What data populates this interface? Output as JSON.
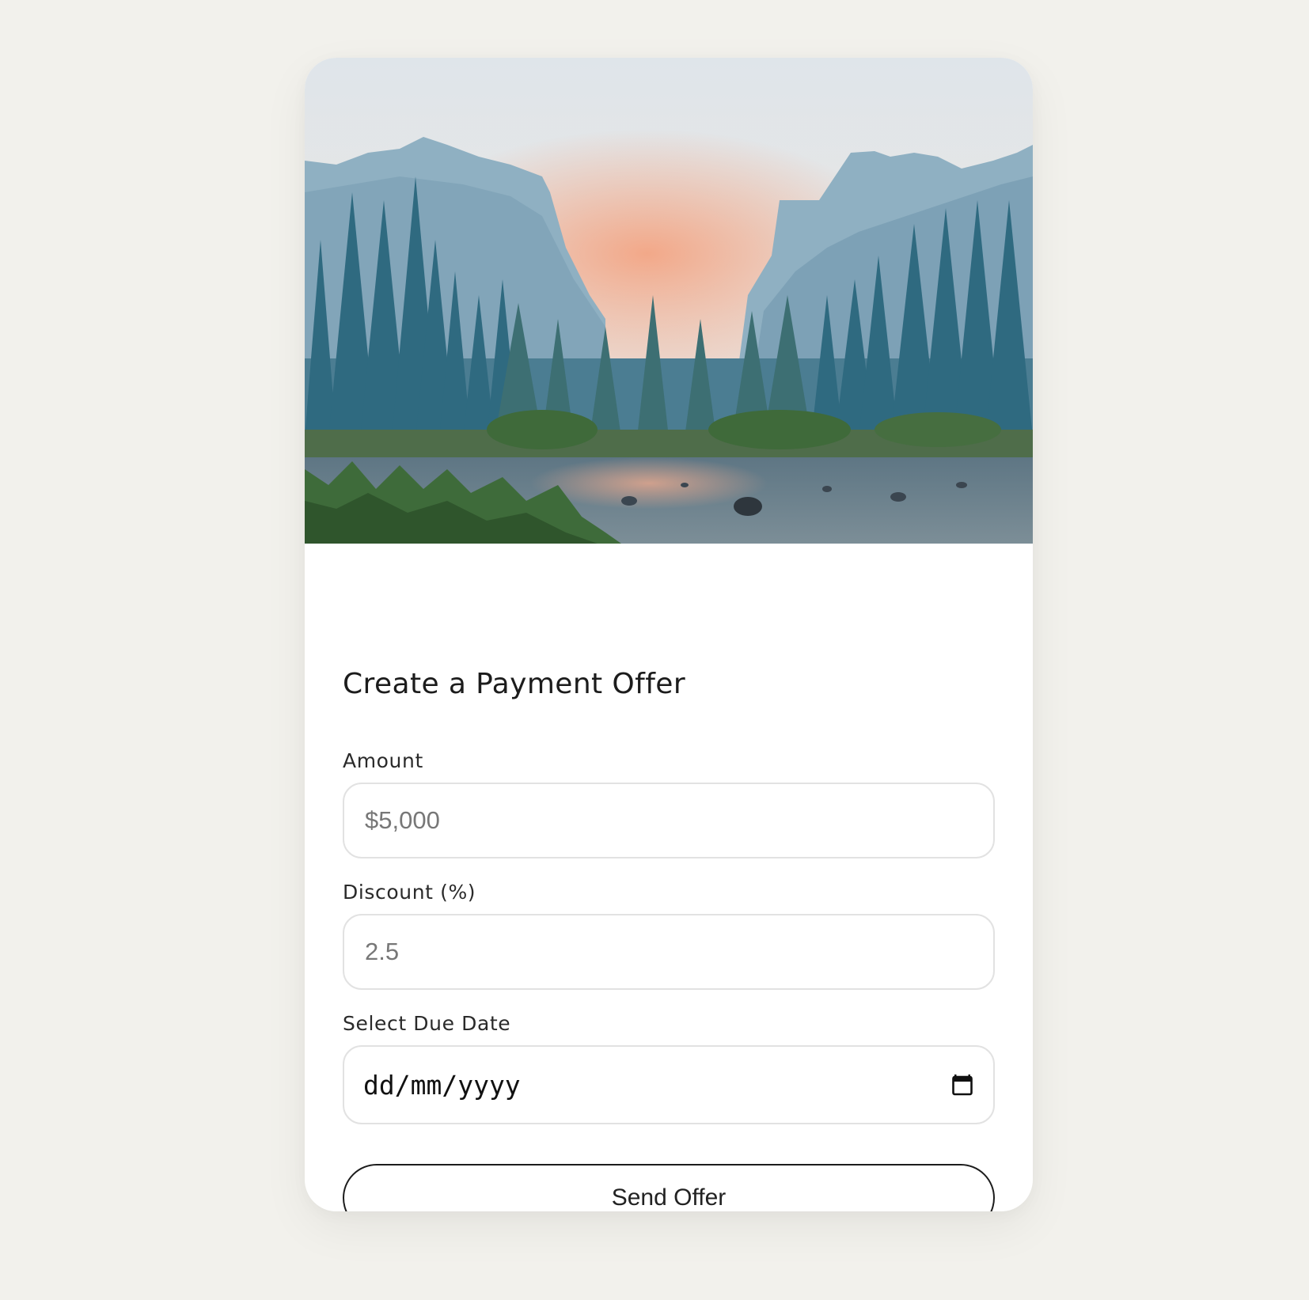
{
  "hero_image": {
    "icon": "mountain-river-landscape",
    "colors": {
      "sky_top": "#dfe5ea",
      "sky_glow": "#f3a584",
      "mountains": "#7fa3b8",
      "trees": "#2f6a80",
      "water": "#6f8592",
      "grass": "#3f6a3a"
    }
  },
  "form": {
    "title": "Create a Payment Offer",
    "amount": {
      "label": "Amount",
      "placeholder": "$5,000"
    },
    "discount": {
      "label": "Discount (%)",
      "placeholder": "2.5"
    },
    "due_date": {
      "label": "Select Due Date",
      "placeholder": "dd/mm/yyyy",
      "icon": "calendar-icon"
    },
    "submit_label": "Send Offer"
  }
}
